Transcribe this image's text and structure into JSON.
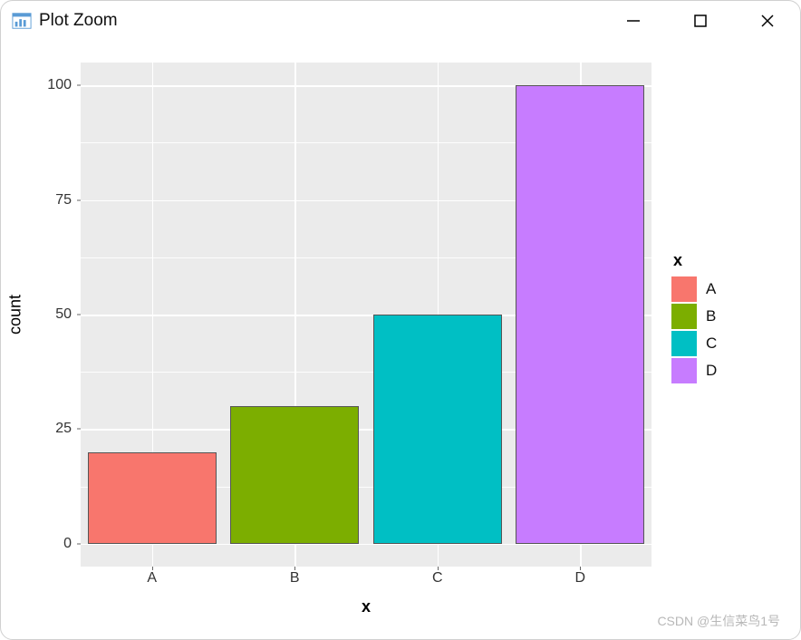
{
  "window": {
    "title": "Plot Zoom"
  },
  "chart_data": {
    "type": "bar",
    "categories": [
      "A",
      "B",
      "C",
      "D"
    ],
    "values": [
      20,
      30,
      50,
      100
    ],
    "colors": [
      "#f8766d",
      "#7cae00",
      "#00bfc4",
      "#c77cff"
    ],
    "ylabel": "count",
    "xlabel": "x",
    "ylim": [
      0,
      100
    ],
    "yticks": [
      0,
      25,
      50,
      75,
      100
    ],
    "legend_title": "x",
    "legend": [
      {
        "label": "A",
        "color": "#f8766d"
      },
      {
        "label": "B",
        "color": "#7cae00"
      },
      {
        "label": "C",
        "color": "#00bfc4"
      },
      {
        "label": "D",
        "color": "#c77cff"
      }
    ]
  },
  "watermark": "CSDN @生信菜鸟1号"
}
